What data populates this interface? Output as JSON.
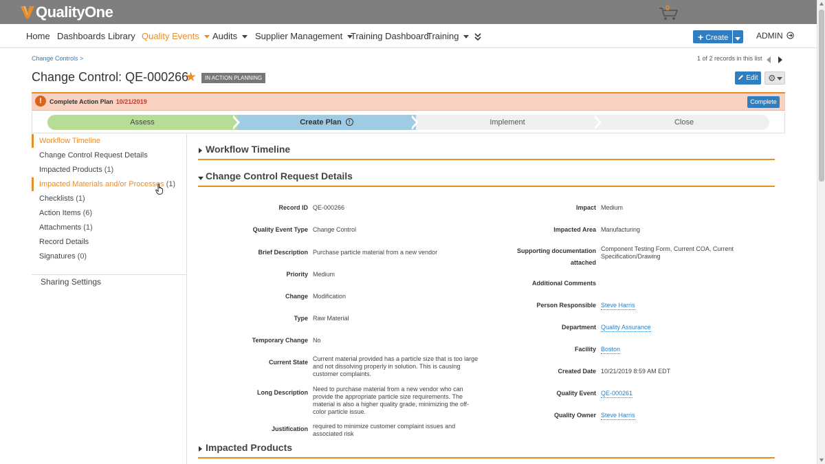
{
  "app": {
    "logo_text": "QualityOne",
    "brand_color": "#e98d2b"
  },
  "nav": {
    "items": [
      "Home",
      "Dashboards",
      "Library",
      "Quality Events",
      "Audits",
      "Supplier Management",
      "Training Dashboard",
      "Training"
    ],
    "active": "Quality Events",
    "more_icon": "double-chevron-down-icon",
    "cart_count": "0",
    "create_label": "Create",
    "admin_label": "ADMIN"
  },
  "header": {
    "breadcrumb": "Change Controls >",
    "records_info": "1 of 2 records in this list",
    "title": "Change Control: QE-000266",
    "state_badge": "IN ACTION PLANNING",
    "edit_label": "Edit"
  },
  "alert": {
    "icon": "exclamation-icon",
    "text": "Complete Action Plan",
    "date": "10/21/2019",
    "button_label": "Complete"
  },
  "stages": [
    {
      "label": "Assess",
      "status": "done",
      "color": "#b6dc96"
    },
    {
      "label": "Create Plan",
      "status": "current",
      "color": "#9fcbe5"
    },
    {
      "label": "Implement",
      "status": "pending",
      "color": "#f0f0f0"
    },
    {
      "label": "Close",
      "status": "pending",
      "color": "#f0f0f0"
    }
  ],
  "leftnav": {
    "items": [
      {
        "label": "Workflow Timeline",
        "count": ""
      },
      {
        "label": "Change Control Request Details",
        "count": ""
      },
      {
        "label": "Impacted Products",
        "count": "(1)"
      },
      {
        "label": "Impacted Materials and/or Processes",
        "count": "(1)"
      },
      {
        "label": "Checklists",
        "count": "(1)"
      },
      {
        "label": "Action Items",
        "count": "(6)"
      },
      {
        "label": "Attachments",
        "count": "(1)"
      },
      {
        "label": "Record Details",
        "count": ""
      },
      {
        "label": "Signatures",
        "count": "(0)"
      }
    ],
    "sharing_label": "Sharing Settings"
  },
  "sections": {
    "workflow_timeline": "Workflow Timeline",
    "request_details": "Change Control Request Details",
    "impacted_products": "Impacted Products"
  },
  "details_left": [
    {
      "label": "Record ID",
      "value": "QE-000266"
    },
    {
      "label": "Quality Event Type",
      "value": "Change Control"
    },
    {
      "label": "Brief Description",
      "value": "Purchase particle material from a new vendor"
    },
    {
      "label": "Priority",
      "value": "Medium"
    },
    {
      "label": "Change",
      "value": "Modification"
    },
    {
      "label": "Type",
      "value": "Raw Material"
    },
    {
      "label": "Temporary Change",
      "value": "No"
    },
    {
      "label": "Current State",
      "lines": [
        "Current material provided has a particle size that is too large",
        "and not dissolving properly in solution.   This is causing",
        "customer complaints."
      ]
    },
    {
      "label": "Long Description",
      "lines": [
        "Need to purchase material from a new vendor who can",
        "provide the appropriate particle size requirements.  The",
        "material is also a higher quality grade, minimizing the off-",
        "color particle issue."
      ]
    },
    {
      "label": "Justification",
      "lines": [
        "required to minimize customer complaint issues and",
        "associated risk"
      ]
    }
  ],
  "details_right": [
    {
      "label": "Impact",
      "value": "Medium"
    },
    {
      "label": "Impacted Area",
      "value": "Manufacturing"
    },
    {
      "label_lines": [
        "Supporting documentation",
        "attached"
      ],
      "lines": [
        "Component Testing Form, Current COA, Current",
        "Specification/Drawing"
      ]
    },
    {
      "label": "Additional Comments",
      "value": ""
    },
    {
      "label": "Person Responsible",
      "value": "Steve Harris",
      "link": true
    },
    {
      "label": "Department",
      "value": "Quality Assurance",
      "link": true
    },
    {
      "label": "Facility",
      "value": "Boston",
      "link": true
    },
    {
      "label": "Created Date",
      "value": "10/21/2019 8:59 AM EDT"
    },
    {
      "label": "Quality Event",
      "value": "QE-000261",
      "link": true
    },
    {
      "label": "Quality Owner",
      "value": "Steve Harris",
      "link": true
    }
  ]
}
